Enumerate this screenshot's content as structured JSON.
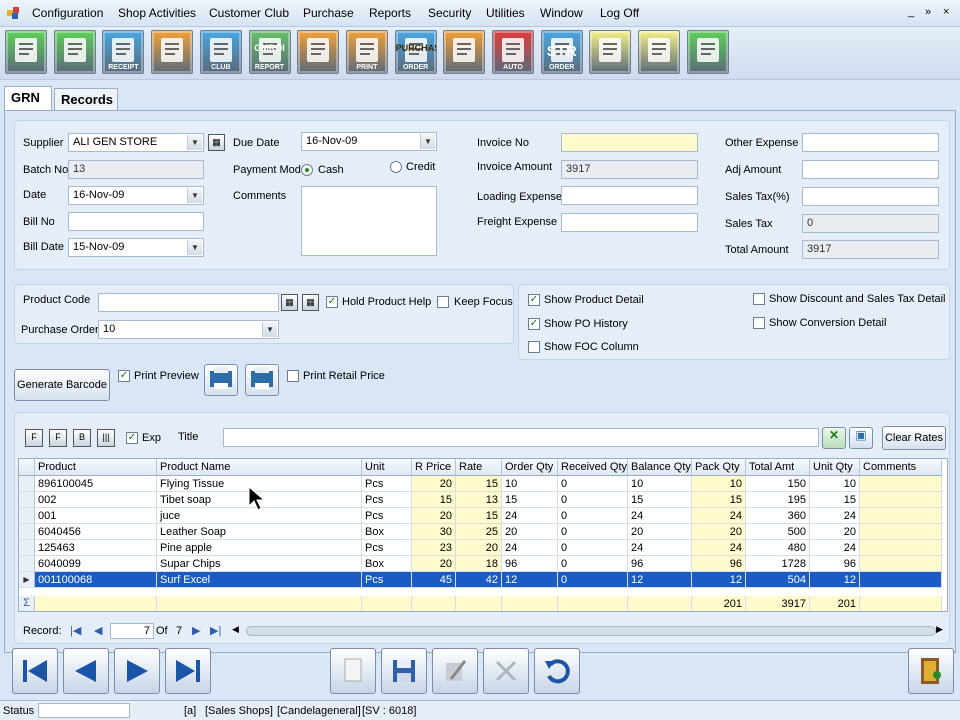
{
  "menu": {
    "items": [
      "Configuration",
      "Shop Activities",
      "Customer Club",
      "Purchase",
      "Reports",
      "Security",
      "Utilities",
      "Window",
      "Log Off"
    ],
    "window_controls": [
      "_",
      "»",
      "×"
    ]
  },
  "toolbar": {
    "buttons": [
      {
        "name": "clipboard-icon",
        "label": "",
        "color": "#5fcf5a"
      },
      {
        "name": "notepad-icon",
        "label": "",
        "color": "#5fcf5a"
      },
      {
        "name": "receipt-printer-icon",
        "label": "RECEIPT",
        "color": "#4aa7e0"
      },
      {
        "name": "orange-tile-icon",
        "label": "",
        "color": "#f2a23a"
      },
      {
        "name": "club-icon",
        "label": "CLUB",
        "color": "#4aa7e0"
      },
      {
        "name": "gmroi-report-icon",
        "label": "REPORT",
        "color": "#6ac06a"
      },
      {
        "name": "orange-tile-icon",
        "label": "",
        "color": "#f2a23a"
      },
      {
        "name": "print-icon",
        "label": "PRINT",
        "color": "#f2a23a"
      },
      {
        "name": "purchase-order-icon",
        "label": "ORDER",
        "color": "#4aa7e0"
      },
      {
        "name": "orange-tile-icon",
        "label": "",
        "color": "#f2a23a"
      },
      {
        "name": "auto-icon",
        "label": "AUTO",
        "color": "#e03c3c"
      },
      {
        "name": "str-order-icon",
        "label": "ORDER",
        "color": "#4aa7e0"
      },
      {
        "name": "calculator-icon",
        "label": "",
        "color": "#f5f18a"
      },
      {
        "name": "percent-icon",
        "label": "",
        "color": "#f5f18a"
      },
      {
        "name": "clipboard-icon",
        "label": "",
        "color": "#5fcf5a"
      }
    ],
    "gmroi_text": "GMROI",
    "purchase_text": "PURCHASE",
    "str_text": "STR"
  },
  "tabs": {
    "grn": "GRN",
    "records": "Records"
  },
  "header": {
    "supplier_label": "Supplier",
    "supplier_value": "ALI GEN STORE",
    "batch_label": "Batch No",
    "batch_value": "13",
    "date_label": "Date",
    "date_value": "16-Nov-09",
    "billno_label": "Bill No",
    "billno_value": "",
    "billdate_label": "Bill Date",
    "billdate_value": "15-Nov-09",
    "duedate_label": "Due Date",
    "duedate_value": "16-Nov-09",
    "paymode_label": "Payment Mod",
    "cash_label": "Cash",
    "credit_label": "Credit",
    "comments_label": "Comments",
    "invoice_no_label": "Invoice No",
    "invoice_no_value": "",
    "invoice_amount_label": "Invoice Amount",
    "invoice_amount_value": "3917",
    "loading_label": "Loading Expense",
    "loading_value": "",
    "freight_label": "Freight Expense",
    "freight_value": "",
    "other_label": "Other Expense",
    "other_value": "",
    "adj_label": "Adj Amount",
    "adj_value": "",
    "salestaxpct_label": "Sales Tax(%)",
    "salestaxpct_value": "",
    "salestax_label": "Sales Tax",
    "salestax_value": "0",
    "total_label": "Total Amount",
    "total_value": "3917"
  },
  "product": {
    "code_label": "Product Code",
    "code_value": "",
    "po_label": "Purchase Order",
    "po_value": "10",
    "hold_help": "Hold Product Help",
    "keep_focus": "Keep Focus",
    "show_detail": "Show Product Detail",
    "show_po": "Show PO History",
    "show_foc": "Show FOC Column",
    "show_discount": "Show Discount and Sales Tax Detail",
    "show_conversion": "Show Conversion Detail",
    "gen_barcode": "Generate Barcode",
    "print_preview": "Print Preview",
    "print_retail": "Print Retail Price"
  },
  "gridbar": {
    "f1": "F",
    "f2": "F",
    "b": "B",
    "exp": "Exp",
    "title_label": "Title",
    "title_value": "",
    "clear_rates": "Clear Rates"
  },
  "grid": {
    "columns": [
      "Product",
      "Product Name",
      "Unit",
      "R Price",
      "Rate",
      "Order Qty",
      "Received Qty",
      "Balance Qty",
      "Pack Qty",
      "Total Amt",
      "Unit Qty",
      "Comments"
    ],
    "rows": [
      [
        "896100045",
        "Flying Tissue",
        "Pcs",
        "20",
        "15",
        "10",
        "0",
        "10",
        "10",
        "150",
        "10",
        ""
      ],
      [
        "002",
        "Tibet soap",
        "Pcs",
        "15",
        "13",
        "15",
        "0",
        "15",
        "15",
        "195",
        "15",
        ""
      ],
      [
        "001",
        "juce",
        "Pcs",
        "20",
        "15",
        "24",
        "0",
        "24",
        "24",
        "360",
        "24",
        ""
      ],
      [
        "6040456",
        "Leather Soap",
        "Box",
        "30",
        "25",
        "20",
        "0",
        "20",
        "20",
        "500",
        "20",
        ""
      ],
      [
        "125463",
        "Pine apple",
        "Pcs",
        "23",
        "20",
        "24",
        "0",
        "24",
        "24",
        "480",
        "24",
        ""
      ],
      [
        "6040099",
        "Supar Chips",
        "Box",
        "20",
        "18",
        "96",
        "0",
        "96",
        "96",
        "1728",
        "96",
        ""
      ],
      [
        "001100068",
        "Surf Excel",
        "Pcs",
        "45",
        "42",
        "12",
        "0",
        "12",
        "12",
        "504",
        "12",
        ""
      ]
    ],
    "totals": {
      "pack": "201",
      "total": "3917",
      "unit": "201"
    },
    "sigma": "Σ"
  },
  "recordnav": {
    "label": "Record:",
    "current": "7",
    "of": "Of",
    "total": "7"
  },
  "status": {
    "label": "Status",
    "items": [
      "[a]",
      "[Sales Shops]",
      "[Candelageneral]",
      "[SV : 6018]"
    ]
  }
}
